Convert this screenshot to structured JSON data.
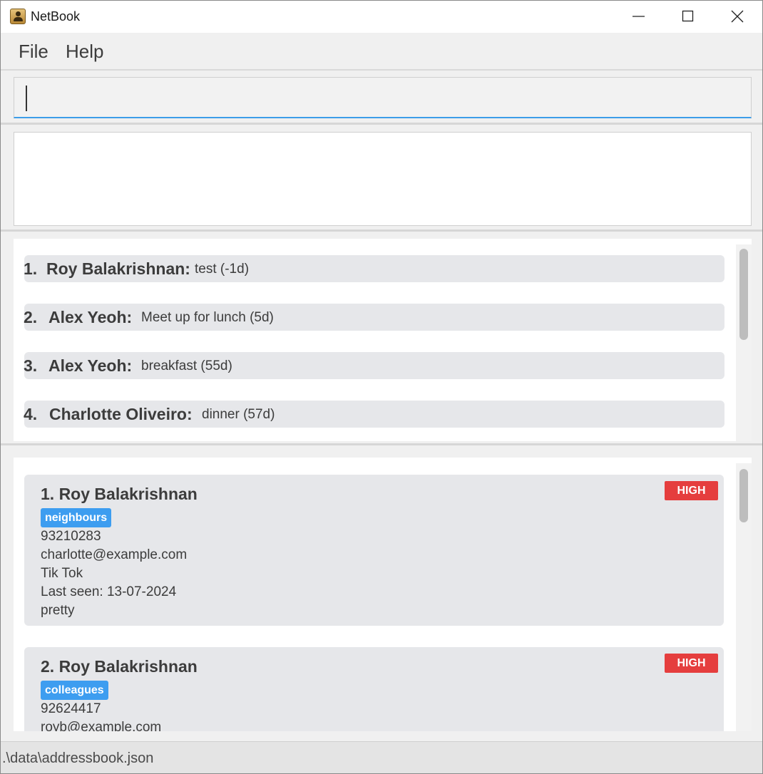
{
  "window": {
    "title": "NetBook"
  },
  "menu": {
    "file": "File",
    "help": "Help"
  },
  "command": {
    "value": "",
    "placeholder": ""
  },
  "result": {
    "text": ""
  },
  "events": [
    {
      "index": "1.",
      "name": "Roy Balakrishnan:",
      "description": "test (-1d)"
    },
    {
      "index": "2.",
      "name": "Alex Yeoh:",
      "description": "Meet up for lunch (5d)"
    },
    {
      "index": "3.",
      "name": "Alex Yeoh:",
      "description": "breakfast (55d)"
    },
    {
      "index": "4.",
      "name": "Charlotte Oliveiro:",
      "description": "dinner (57d)"
    }
  ],
  "persons": [
    {
      "title": "1. Roy Balakrishnan",
      "tag": "neighbours",
      "priority": "HIGH",
      "phone": "93210283",
      "email": "charlotte@example.com",
      "platform": "Tik Tok",
      "last_seen": "Last seen: 13-07-2024",
      "remark": "pretty"
    },
    {
      "title": "2. Roy Balakrishnan",
      "tag": "colleagues",
      "priority": "HIGH",
      "phone": "92624417",
      "email": "royb@example.com",
      "platform": "",
      "last_seen": "",
      "remark": ""
    }
  ],
  "status": {
    "file_path": ".\\data\\addressbook.json"
  },
  "colors": {
    "accent": "#3d9df0",
    "priority_high": "#e53e3e",
    "card": "#e6e7ea"
  }
}
